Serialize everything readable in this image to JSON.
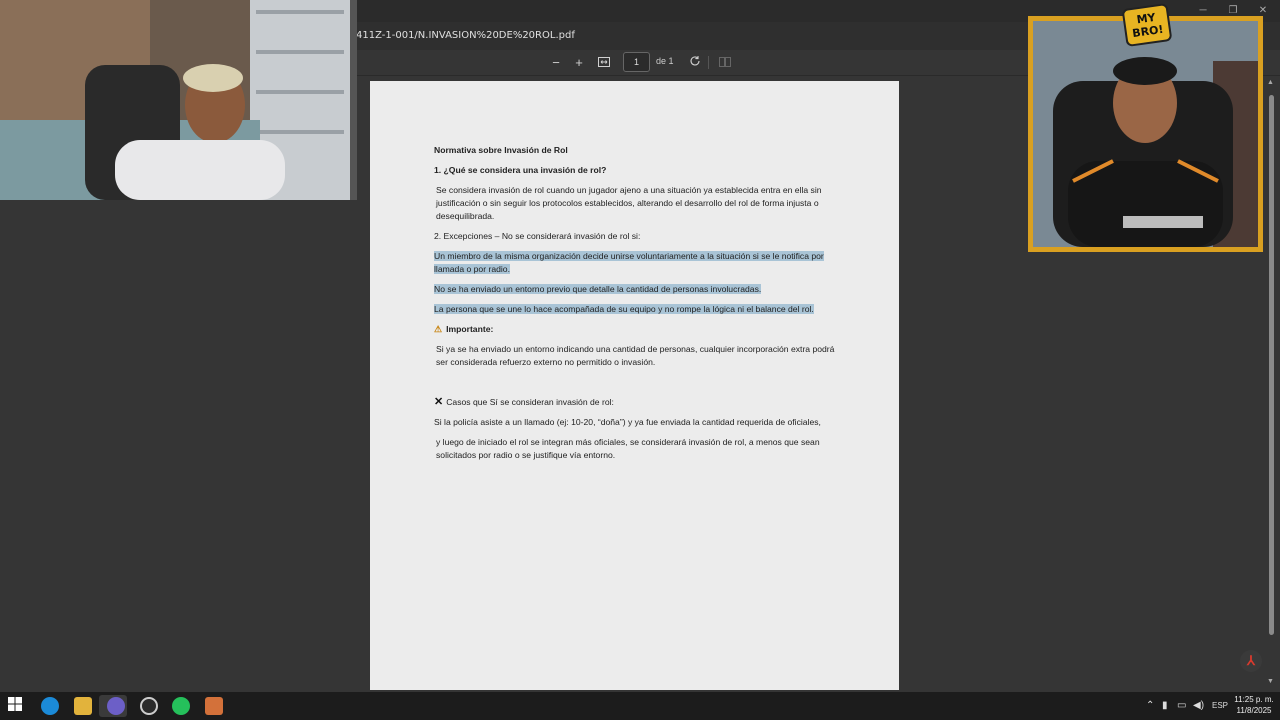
{
  "browser": {
    "url": "411Z-1-001/N.INVASION%20DE%20ROL.pdf"
  },
  "pdf_toolbar": {
    "zoom_out": "−",
    "zoom_in": "+",
    "page_current": "1",
    "page_of": "de 1"
  },
  "document": {
    "title": "Normativa sobre Invasión de Rol",
    "q1_heading": "1. ¿Qué se considera una invasión de rol?",
    "q1_body": "Se considera invasión de rol cuando un jugador ajeno a una situación ya establecida entra en ella sin justificación o sin seguir los protocolos establecidos, alterando el desarrollo del rol de forma injusta o desequilibrada.",
    "exceptions_heading": "2. Excepciones – No se considerará invasión de rol si:",
    "exceptions": [
      "Un miembro de la misma organización decide unirse voluntariamente a la situación  si se le notifica por llamada o por radio.",
      "No se ha enviado un entorno previo que detalle la cantidad de personas involucradas.",
      "La persona que se une lo hace acompañada de su equipo y no rompe la lógica ni el balance del rol."
    ],
    "important_label": "Importante:",
    "important_body": "Si ya se ha enviado un entorno indicando una cantidad de personas, cualquier incorporación extra podrá ser considerada refuerzo externo no permitido o invasión.",
    "cases_heading": "Casos que Sí se consideran invasión de rol:",
    "case_1": "Si la policía asiste a un llamado (ej: 10-20, “doña”) y ya fue enviada la cantidad requerida de oficiales,",
    "case_2": "y luego de iniciado el rol se integran más oficiales, se considerará invasión de rol, a menos que sean solicitados por radio o se justifique vía entorno."
  },
  "overlay": {
    "badge_line1": "MY",
    "badge_line2": "BRO!"
  },
  "taskbar": {
    "lang": "ESP",
    "time": "11:25 p. m.",
    "date": "11/8/2025"
  }
}
